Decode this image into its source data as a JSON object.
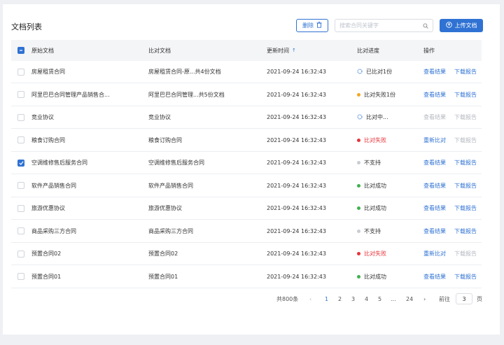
{
  "page": {
    "title": "文档列表"
  },
  "toolbar": {
    "delete_label": "删除",
    "search_placeholder": "搜索合同关键字",
    "upload_label": "上传文档"
  },
  "table": {
    "columns": {
      "original": "原始文档",
      "compare": "比对文档",
      "updated": "更新时间",
      "progress": "比对进度",
      "actions": "操作"
    },
    "rows": [
      {
        "checked": false,
        "original": "房屋租赁合同",
        "compare": "房屋租赁合同-原...共4份文档",
        "time": "2021-09-24 16:32:43",
        "status": "已比对1份",
        "status_color": "#2f72d3",
        "status_icon": "progress-ring-icon",
        "action1": "查看结果",
        "action1_enabled": true,
        "action2": "下载报告",
        "action2_enabled": true
      },
      {
        "checked": false,
        "original": "阿里巴巴合同管理产品销售合...",
        "compare": "阿里巴巴合同管理...共5份文档",
        "time": "2021-09-24 16:32:43",
        "status": "比对失败1份",
        "status_color": "#f5a623",
        "status_icon": "dot-icon",
        "action1": "查看结果",
        "action1_enabled": true,
        "action2": "下载报告",
        "action2_enabled": true
      },
      {
        "checked": false,
        "original": "竞业协议",
        "compare": "竞业协议",
        "time": "2021-09-24 16:32:43",
        "status": "比对中...",
        "status_color": "#2f72d3",
        "status_icon": "progress-ring-icon",
        "action1": "查看结果",
        "action1_enabled": false,
        "action2": "下载报告",
        "action2_enabled": false
      },
      {
        "checked": false,
        "original": "粮食订购合同",
        "compare": "粮食订购合同",
        "time": "2021-09-24 16:32:43",
        "status": "比对失败",
        "status_color": "#e8343a",
        "status_icon": "dot-icon",
        "status_text_color": "#e8343a",
        "action1": "重新比对",
        "action1_enabled": true,
        "action2": "下载报告",
        "action2_enabled": false
      },
      {
        "checked": true,
        "original": "空调维修售后服务合同",
        "compare": "空调维修售后服务合同",
        "time": "2021-09-24 16:32:43",
        "status": "不支持",
        "status_color": "#c8ccd2",
        "status_icon": "dot-icon",
        "action1": "查看结果",
        "action1_enabled": true,
        "action2": "下载报告",
        "action2_enabled": true
      },
      {
        "checked": false,
        "original": "软件产品销售合同",
        "compare": "软件产品销售合同",
        "time": "2021-09-24 16:32:43",
        "status": "比对成功",
        "status_color": "#3fb34f",
        "status_icon": "dot-icon",
        "action1": "查看结果",
        "action1_enabled": true,
        "action2": "下载报告",
        "action2_enabled": true
      },
      {
        "checked": false,
        "original": "旅游优惠协议",
        "compare": "旅游优惠协议",
        "time": "2021-09-24 16:32:43",
        "status": "比对成功",
        "status_color": "#3fb34f",
        "status_icon": "dot-icon",
        "action1": "查看结果",
        "action1_enabled": true,
        "action2": "下载报告",
        "action2_enabled": true
      },
      {
        "checked": false,
        "original": "商品采购三方合同",
        "compare": "商品采购三方合同",
        "time": "2021-09-24 16:32:43",
        "status": "不支持",
        "status_color": "#c8ccd2",
        "status_icon": "dot-icon",
        "action1": "查看结果",
        "action1_enabled": true,
        "action2": "下载报告",
        "action2_enabled": true
      },
      {
        "checked": false,
        "original": "预置合同02",
        "compare": "预置合同02",
        "time": "2021-09-24 16:32:43",
        "status": "比对失败",
        "status_color": "#e8343a",
        "status_icon": "dot-icon",
        "status_text_color": "#e8343a",
        "action1": "重新比对",
        "action1_enabled": true,
        "action2": "下载报告",
        "action2_enabled": false
      },
      {
        "checked": false,
        "original": "预置合同01",
        "compare": "预置合同01",
        "time": "2021-09-24 16:32:43",
        "status": "比对成功",
        "status_color": "#3fb34f",
        "status_icon": "dot-icon",
        "action1": "查看结果",
        "action1_enabled": true,
        "action2": "下载报告",
        "action2_enabled": true
      }
    ]
  },
  "pagination": {
    "total": "共800条",
    "pages": [
      "1",
      "2",
      "3",
      "4",
      "5"
    ],
    "ellipsis": "...",
    "last": "24",
    "current": "1",
    "goto_label": "前往",
    "goto_value": "3",
    "page_suffix": "页"
  },
  "colors": {
    "accent": "#2f72d3",
    "success": "#3fb34f",
    "error": "#e8343a",
    "warning": "#f5a623"
  }
}
